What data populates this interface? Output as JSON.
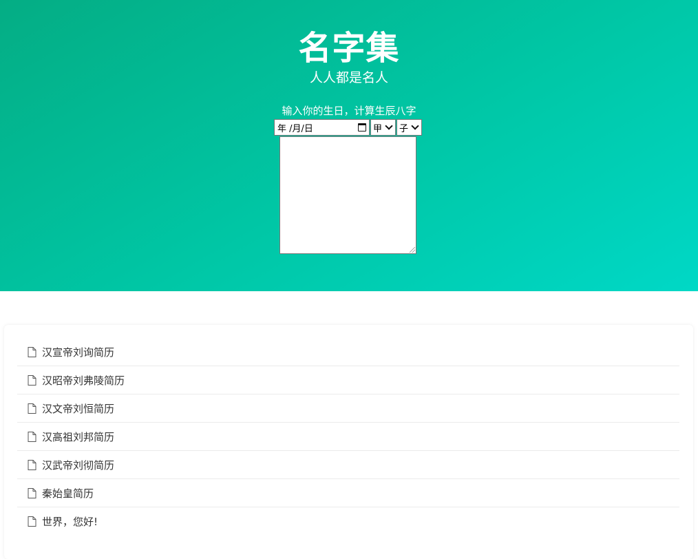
{
  "hero": {
    "title": "名字集",
    "subtitle": "人人都是名人",
    "prompt": "输入你的生日，计算生辰八字"
  },
  "form": {
    "date_placeholder": "年 /月/日",
    "stem_selected": "甲",
    "branch_selected": "子",
    "result_text": ""
  },
  "posts": [
    {
      "title": "汉宣帝刘询简历",
      "icon": "document-icon"
    },
    {
      "title": "汉昭帝刘弗陵简历",
      "icon": "document-icon"
    },
    {
      "title": "汉文帝刘恒简历",
      "icon": "document-icon"
    },
    {
      "title": "汉高祖刘邦简历",
      "icon": "document-icon"
    },
    {
      "title": "汉武帝刘彻简历",
      "icon": "document-icon"
    },
    {
      "title": "秦始皇简历",
      "icon": "document-icon"
    },
    {
      "title": "世界，您好!",
      "icon": "document-icon"
    }
  ],
  "colors": {
    "hero_start": "#04ad84",
    "hero_end": "#00d8c6",
    "text_on_hero": "#ffffff",
    "list_text": "#333333"
  }
}
